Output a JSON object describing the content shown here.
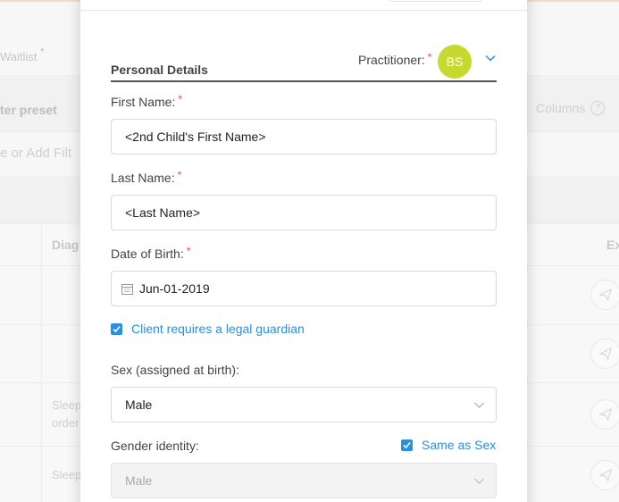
{
  "background": {
    "waitlist_label": "Waitlist",
    "required_mark": "*",
    "preset_label": "ter preset",
    "columns_label": "Columns",
    "help_icon": "?",
    "filter_placeholder": "e or Add Filt",
    "table_headers": [
      "Diag",
      "Ex"
    ],
    "rows": [
      {
        "text": ""
      },
      {
        "text": ""
      },
      {
        "text": "Sleep\norder"
      },
      {
        "text": "Sleep"
      }
    ]
  },
  "modal": {
    "section_title": "Personal Details",
    "practitioner_label": "Practitioner:",
    "practitioner_initials": "BS",
    "required_mark": "*",
    "first_name": {
      "label": "First Name:",
      "value": "<2nd Child's First Name>"
    },
    "last_name": {
      "label": "Last Name:",
      "value": "<Last Name>"
    },
    "dob": {
      "label": "Date of Birth:",
      "value": "Jun-01-2019"
    },
    "legal_guardian_label": "Client requires a legal guardian",
    "sex": {
      "label": "Sex (assigned at birth):",
      "value": "Male"
    },
    "gender": {
      "label": "Gender identity:",
      "same_as_label": "Same as Sex",
      "value": "Male"
    }
  },
  "colors": {
    "accent": "#2a8fe0",
    "avatar": "#c5d92e",
    "required": "#e74c3c"
  }
}
